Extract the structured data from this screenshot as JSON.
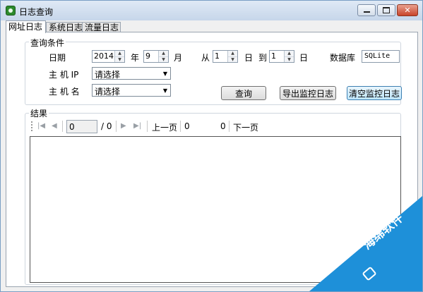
{
  "window": {
    "title": "日志查询",
    "minimize_glyph": "",
    "close_glyph": "✕"
  },
  "tabs": [
    "网址日志",
    "系统日志",
    "流量日志"
  ],
  "query": {
    "group_label": "查询条件",
    "date_label": "日期",
    "year_value": "2014",
    "year_unit": "年",
    "month_value": "9",
    "month_unit": "月",
    "from_label": "从",
    "from_day": "1",
    "day_unit_1": "日",
    "to_label": "到",
    "to_day": "1",
    "day_unit_2": "日",
    "database_label": "数据库",
    "database_value": "SQLite",
    "host_ip_label": "主 机 IP",
    "host_ip_value": "请选择",
    "host_name_label": "主 机 名",
    "host_name_value": "请选择",
    "query_button": "查询",
    "export_button": "导出监控日志",
    "clear_button": "清空监控日志"
  },
  "results": {
    "group_label": "结果",
    "page_value": "0",
    "page_total": "/ 0",
    "prev_label": "上一页",
    "current_input": "0",
    "current_count": "0",
    "next_label": "下一页"
  },
  "watermark": {
    "text": "海绵软件"
  }
}
